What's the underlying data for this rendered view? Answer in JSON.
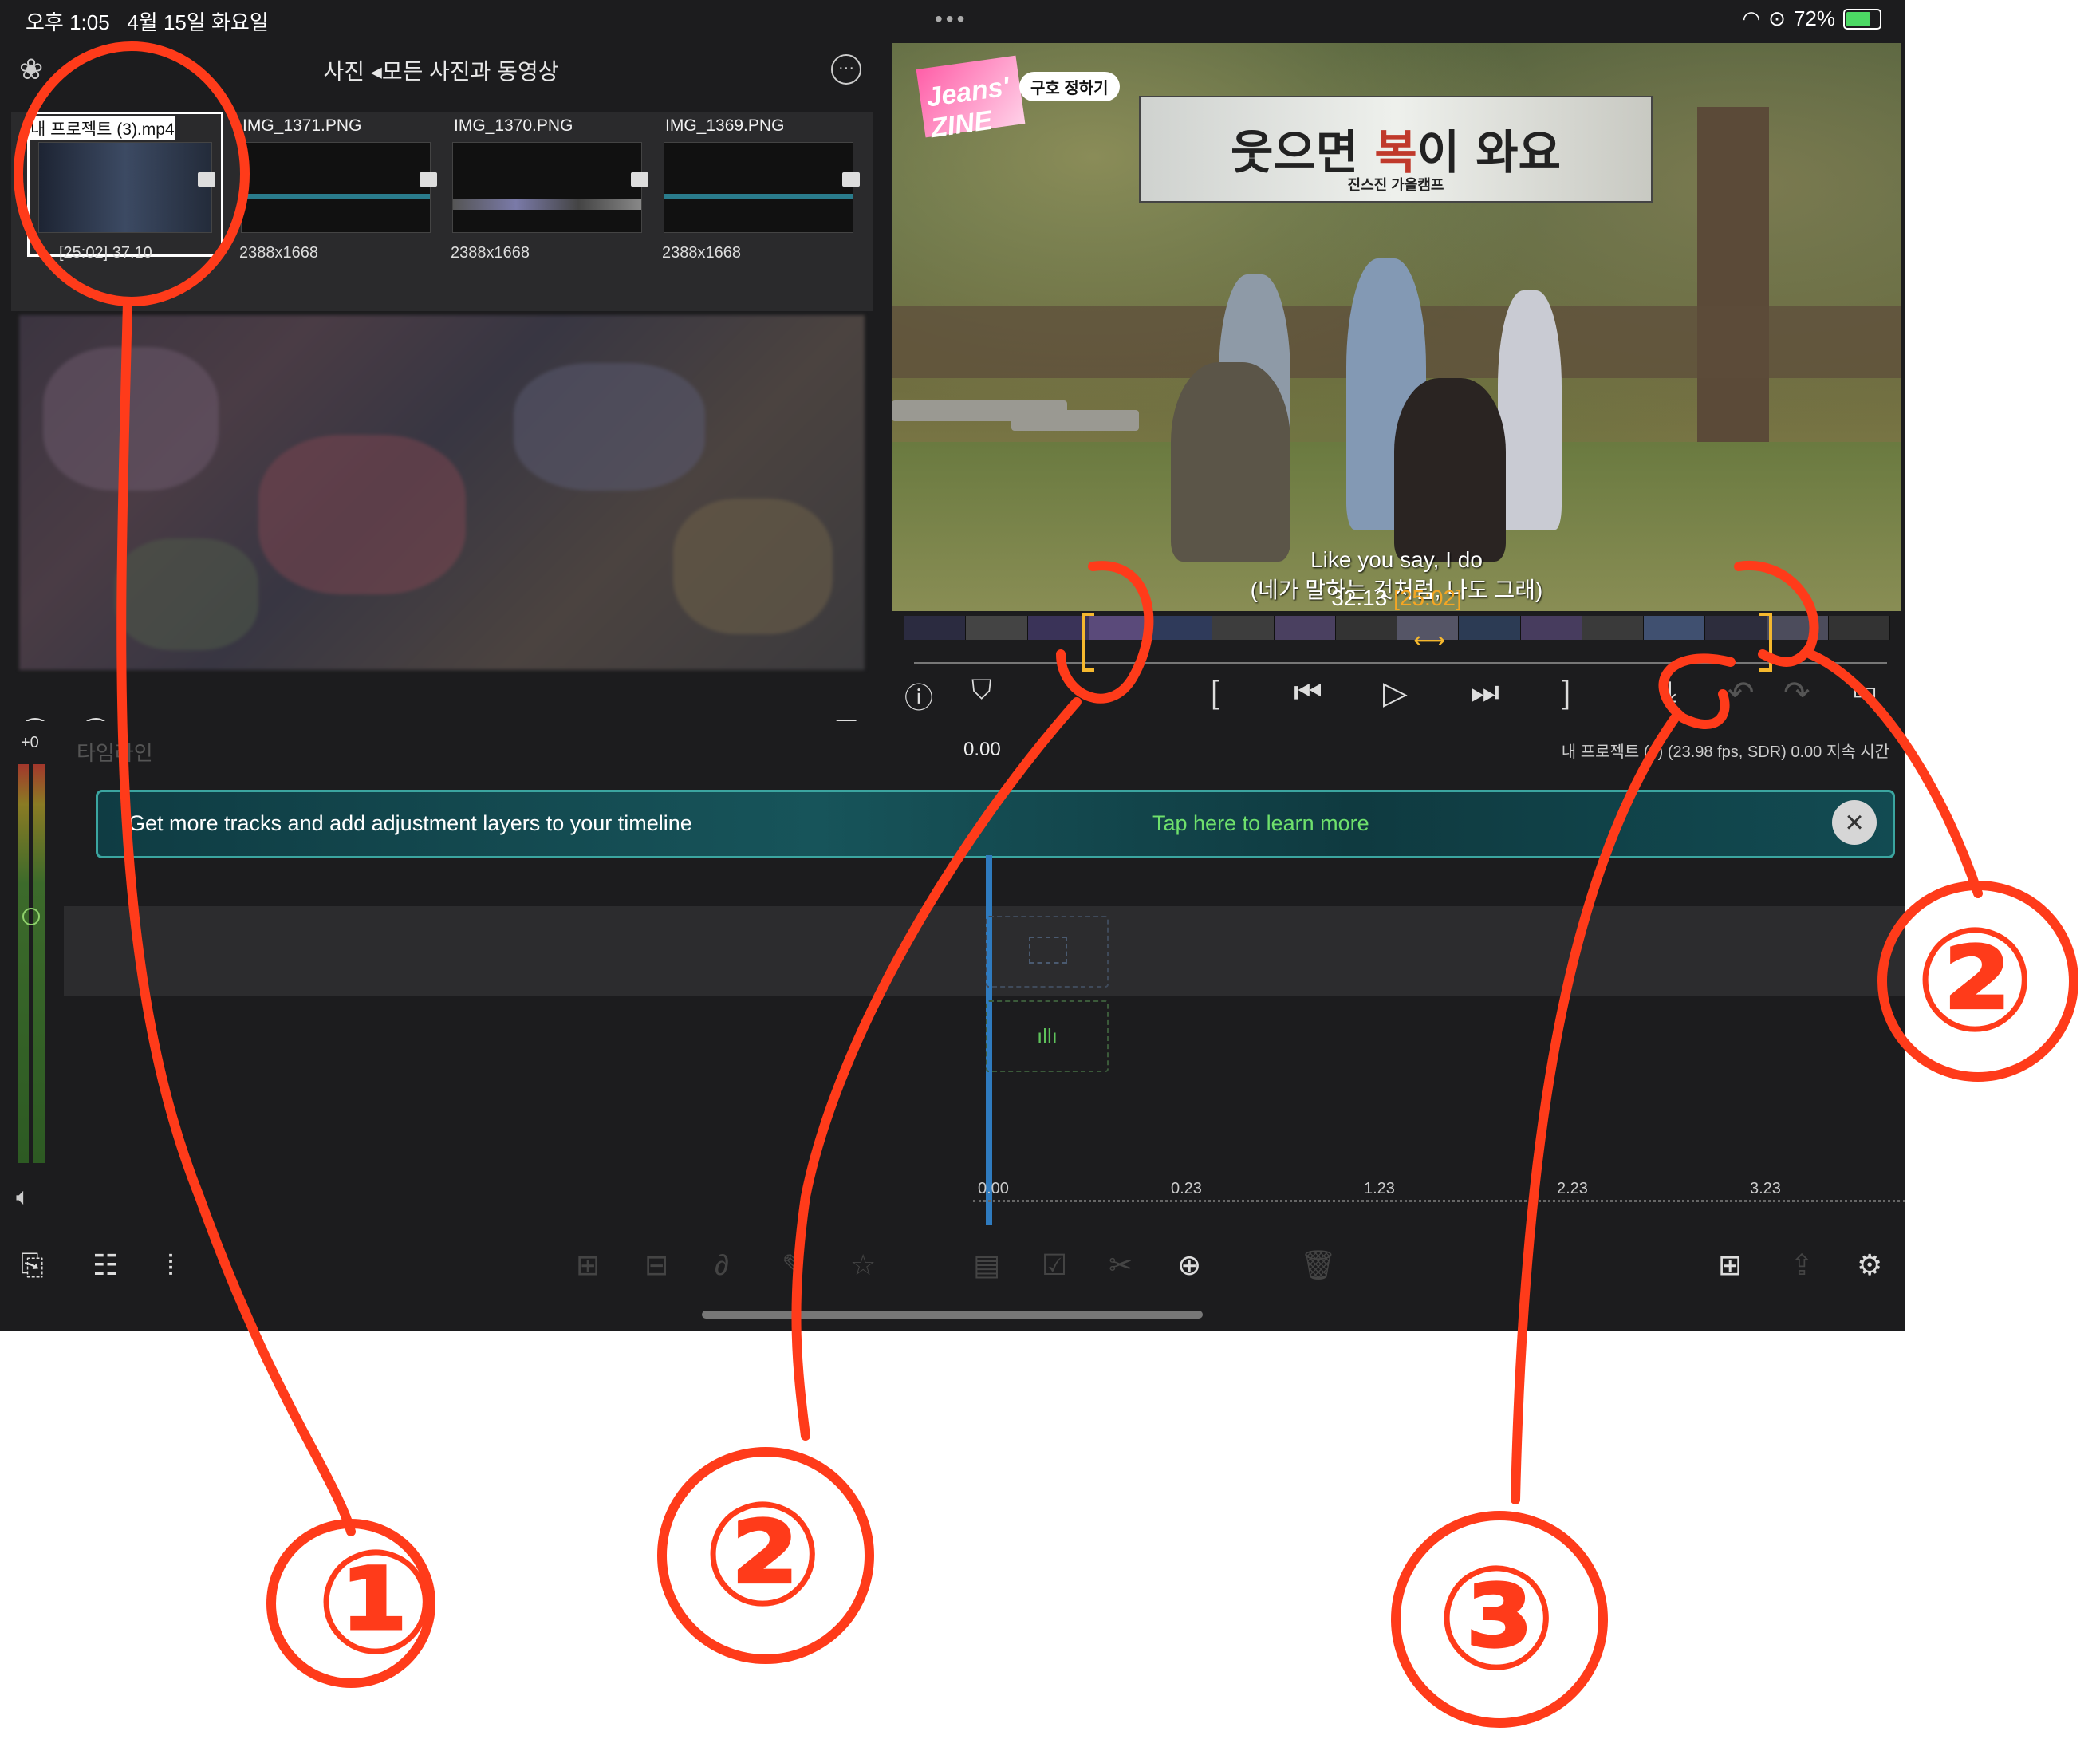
{
  "status_bar": {
    "time": "오후 1:05",
    "date": "4월 15일 화요일",
    "more": "•••",
    "battery": "72%"
  },
  "browser": {
    "title": "사진 ◂모든 사진과 동영상",
    "items": [
      {
        "name": "내 프로젝트 (3).mp4",
        "meta": "[25:02]  37.10"
      },
      {
        "name": "IMG_1371.PNG",
        "meta": "2388x1668"
      },
      {
        "name": "IMG_1370.PNG",
        "meta": "2388x1668"
      },
      {
        "name": "IMG_1369.PNG",
        "meta": "2388x1668"
      }
    ]
  },
  "viewer": {
    "logo": "Jeans' ZINE",
    "tag": "구호 정하기",
    "banner_title_a": "웃으면 ",
    "banner_title_b": "복",
    "banner_title_c": "이 와요",
    "banner_sub": "진스진 가을캠프",
    "subtitle_en": "Like you say, I do",
    "subtitle_ko": "(네가 말하는 것처럼, 나도 그래)",
    "timecode_current": "32.13",
    "timecode_range": "[25:02]"
  },
  "timeline": {
    "level": "+0",
    "label": "타임라인",
    "time": "0.00",
    "project_info": "내 프로젝트 (4) (23.98 fps, SDR) 0.00 지속 시간",
    "promo_text": "Get more tracks and add adjustment layers to your timeline",
    "promo_link": "Tap here to learn more",
    "ruler": [
      "0.00",
      "0.23",
      "1.23",
      "2.23",
      "3.23"
    ]
  },
  "icons": {
    "flower": "photos-flower-icon",
    "more": "ellipsis-icon",
    "check": "checkmark-circle-icon",
    "record": "record-icon",
    "search": "search-icon",
    "list": "list-icon",
    "info": "info-icon",
    "marker": "marker-icon",
    "in": "in-point-icon",
    "prev": "skip-back-icon",
    "play": "play-icon",
    "next": "skip-forward-icon",
    "out": "out-point-icon",
    "insert": "insert-down-icon",
    "undo": "undo-icon",
    "redo": "redo-icon",
    "fullscreen": "fullscreen-icon"
  },
  "annotations": [
    "①",
    "②",
    "②",
    "③"
  ],
  "colors": {
    "accent_orange": "#f5b82e",
    "annotation_red": "#ff3b1a",
    "promo_link_green": "#6fe06c"
  }
}
